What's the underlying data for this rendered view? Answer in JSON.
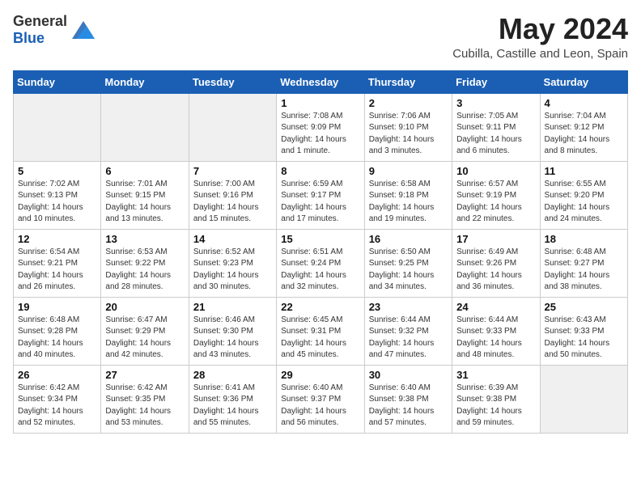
{
  "header": {
    "logo_general": "General",
    "logo_blue": "Blue",
    "month": "May 2024",
    "location": "Cubilla, Castille and Leon, Spain"
  },
  "weekdays": [
    "Sunday",
    "Monday",
    "Tuesday",
    "Wednesday",
    "Thursday",
    "Friday",
    "Saturday"
  ],
  "weeks": [
    [
      {
        "day": "",
        "empty": true
      },
      {
        "day": "",
        "empty": true
      },
      {
        "day": "",
        "empty": true
      },
      {
        "day": "1",
        "sunrise": "7:08 AM",
        "sunset": "9:09 PM",
        "daylight": "14 hours and 1 minute."
      },
      {
        "day": "2",
        "sunrise": "7:06 AM",
        "sunset": "9:10 PM",
        "daylight": "14 hours and 3 minutes."
      },
      {
        "day": "3",
        "sunrise": "7:05 AM",
        "sunset": "9:11 PM",
        "daylight": "14 hours and 6 minutes."
      },
      {
        "day": "4",
        "sunrise": "7:04 AM",
        "sunset": "9:12 PM",
        "daylight": "14 hours and 8 minutes."
      }
    ],
    [
      {
        "day": "5",
        "sunrise": "7:02 AM",
        "sunset": "9:13 PM",
        "daylight": "14 hours and 10 minutes."
      },
      {
        "day": "6",
        "sunrise": "7:01 AM",
        "sunset": "9:15 PM",
        "daylight": "14 hours and 13 minutes."
      },
      {
        "day": "7",
        "sunrise": "7:00 AM",
        "sunset": "9:16 PM",
        "daylight": "14 hours and 15 minutes."
      },
      {
        "day": "8",
        "sunrise": "6:59 AM",
        "sunset": "9:17 PM",
        "daylight": "14 hours and 17 minutes."
      },
      {
        "day": "9",
        "sunrise": "6:58 AM",
        "sunset": "9:18 PM",
        "daylight": "14 hours and 19 minutes."
      },
      {
        "day": "10",
        "sunrise": "6:57 AM",
        "sunset": "9:19 PM",
        "daylight": "14 hours and 22 minutes."
      },
      {
        "day": "11",
        "sunrise": "6:55 AM",
        "sunset": "9:20 PM",
        "daylight": "14 hours and 24 minutes."
      }
    ],
    [
      {
        "day": "12",
        "sunrise": "6:54 AM",
        "sunset": "9:21 PM",
        "daylight": "14 hours and 26 minutes."
      },
      {
        "day": "13",
        "sunrise": "6:53 AM",
        "sunset": "9:22 PM",
        "daylight": "14 hours and 28 minutes."
      },
      {
        "day": "14",
        "sunrise": "6:52 AM",
        "sunset": "9:23 PM",
        "daylight": "14 hours and 30 minutes."
      },
      {
        "day": "15",
        "sunrise": "6:51 AM",
        "sunset": "9:24 PM",
        "daylight": "14 hours and 32 minutes."
      },
      {
        "day": "16",
        "sunrise": "6:50 AM",
        "sunset": "9:25 PM",
        "daylight": "14 hours and 34 minutes."
      },
      {
        "day": "17",
        "sunrise": "6:49 AM",
        "sunset": "9:26 PM",
        "daylight": "14 hours and 36 minutes."
      },
      {
        "day": "18",
        "sunrise": "6:48 AM",
        "sunset": "9:27 PM",
        "daylight": "14 hours and 38 minutes."
      }
    ],
    [
      {
        "day": "19",
        "sunrise": "6:48 AM",
        "sunset": "9:28 PM",
        "daylight": "14 hours and 40 minutes."
      },
      {
        "day": "20",
        "sunrise": "6:47 AM",
        "sunset": "9:29 PM",
        "daylight": "14 hours and 42 minutes."
      },
      {
        "day": "21",
        "sunrise": "6:46 AM",
        "sunset": "9:30 PM",
        "daylight": "14 hours and 43 minutes."
      },
      {
        "day": "22",
        "sunrise": "6:45 AM",
        "sunset": "9:31 PM",
        "daylight": "14 hours and 45 minutes."
      },
      {
        "day": "23",
        "sunrise": "6:44 AM",
        "sunset": "9:32 PM",
        "daylight": "14 hours and 47 minutes."
      },
      {
        "day": "24",
        "sunrise": "6:44 AM",
        "sunset": "9:33 PM",
        "daylight": "14 hours and 48 minutes."
      },
      {
        "day": "25",
        "sunrise": "6:43 AM",
        "sunset": "9:33 PM",
        "daylight": "14 hours and 50 minutes."
      }
    ],
    [
      {
        "day": "26",
        "sunrise": "6:42 AM",
        "sunset": "9:34 PM",
        "daylight": "14 hours and 52 minutes."
      },
      {
        "day": "27",
        "sunrise": "6:42 AM",
        "sunset": "9:35 PM",
        "daylight": "14 hours and 53 minutes."
      },
      {
        "day": "28",
        "sunrise": "6:41 AM",
        "sunset": "9:36 PM",
        "daylight": "14 hours and 55 minutes."
      },
      {
        "day": "29",
        "sunrise": "6:40 AM",
        "sunset": "9:37 PM",
        "daylight": "14 hours and 56 minutes."
      },
      {
        "day": "30",
        "sunrise": "6:40 AM",
        "sunset": "9:38 PM",
        "daylight": "14 hours and 57 minutes."
      },
      {
        "day": "31",
        "sunrise": "6:39 AM",
        "sunset": "9:38 PM",
        "daylight": "14 hours and 59 minutes."
      },
      {
        "day": "",
        "empty": true
      }
    ]
  ],
  "labels": {
    "sunrise_prefix": "Sunrise: ",
    "sunset_prefix": "Sunset: ",
    "daylight_prefix": "Daylight: "
  }
}
